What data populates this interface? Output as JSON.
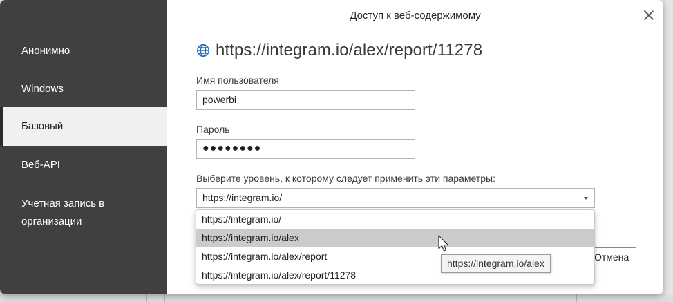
{
  "dialog": {
    "title": "Доступ к веб-содержимому",
    "close_icon": "close-icon"
  },
  "sidebar": {
    "items": [
      {
        "label": "Анонимно",
        "selected": false
      },
      {
        "label": "Windows",
        "selected": false
      },
      {
        "label": "Базовый",
        "selected": true
      },
      {
        "label": "Веб-API",
        "selected": false
      },
      {
        "label": "Учетная запись в",
        "label2": "организации",
        "selected": false
      }
    ]
  },
  "main": {
    "url_icon": "globe-icon",
    "url": "https://integram.io/alex/report/11278",
    "username_label": "Имя пользователя",
    "username_value": "powerbi",
    "password_label": "Пароль",
    "password_value": "●●●●●●●●",
    "level_label": "Выберите уровень, к которому следует применить эти параметры:",
    "level_selected": "https://integram.io/",
    "level_options": [
      "https://integram.io/",
      "https://integram.io/alex",
      "https://integram.io/alex/report",
      "https://integram.io/alex/report/11278"
    ],
    "hovered_option": "https://integram.io/alex",
    "tooltip": "https://integram.io/alex",
    "cancel_label": "Отмена"
  },
  "colors": {
    "sidebar_bg": "#404040",
    "selected_bg": "#f0f0f0",
    "hover_bg": "#cbcbcb"
  }
}
